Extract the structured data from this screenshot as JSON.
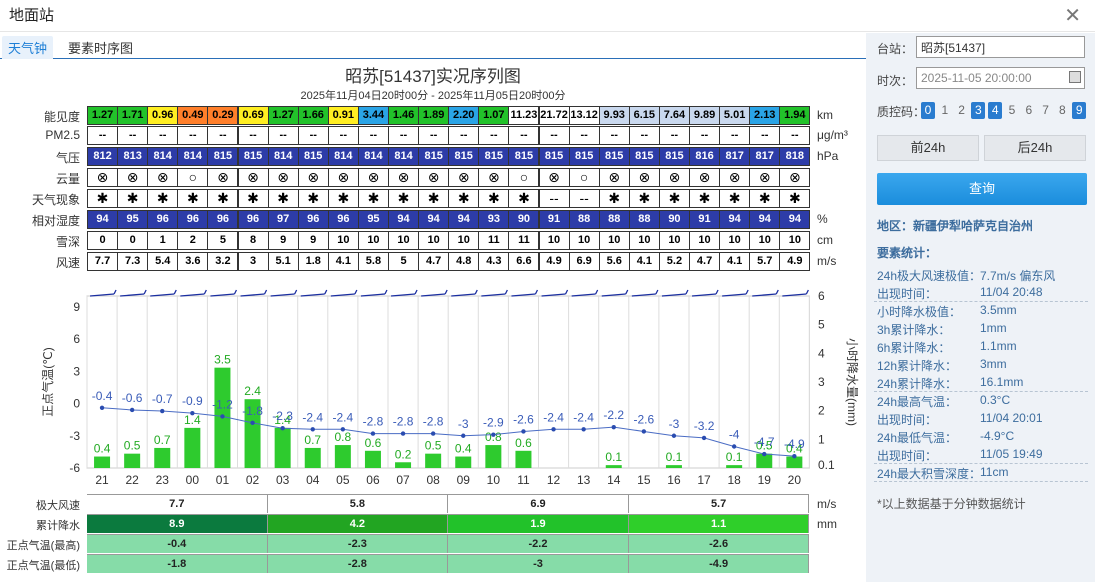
{
  "window": {
    "title": "地面站"
  },
  "tabs": [
    {
      "label": "天气钟",
      "active": true
    },
    {
      "label": "要素时序图",
      "active": false
    }
  ],
  "chart": {
    "title": "昭苏[51437]实况序列图",
    "subtitle": "2025年11月04日20时00分 - 2025年11月05日20时00分"
  },
  "rows": {
    "visibility": {
      "label": "能见度",
      "unit": "km",
      "values": [
        "1.27",
        "1.71",
        "0.96",
        "0.49",
        "0.29",
        "0.69",
        "1.27",
        "1.66",
        "0.91",
        "3.44",
        "1.46",
        "1.89",
        "2.20",
        "1.07",
        "11.23",
        "21.72",
        "13.12",
        "9.93",
        "6.15",
        "7.64",
        "9.89",
        "5.01",
        "2.13",
        "1.94"
      ],
      "colors": [
        "#22c22a",
        "#22c22a",
        "#ffee22",
        "#ff7f2a",
        "#ff7f2a",
        "#ffee22",
        "#22c22a",
        "#22c22a",
        "#ffee22",
        "#2aa4e6",
        "#22c22a",
        "#22c22a",
        "#2aa4e6",
        "#22c22a",
        "#ffffff",
        "#ffffff",
        "#ffffff",
        "#c9d8ee",
        "#c9d8ee",
        "#c9d8ee",
        "#c9d8ee",
        "#c9d8ee",
        "#2aa4e6",
        "#22c22a"
      ]
    },
    "pm25": {
      "label": "PM2.5",
      "unit": "μg/m³",
      "values": [
        "--",
        "--",
        "--",
        "--",
        "--",
        "--",
        "--",
        "--",
        "--",
        "--",
        "--",
        "--",
        "--",
        "--",
        "--",
        "--",
        "--",
        "--",
        "--",
        "--",
        "--",
        "--",
        "--",
        "--"
      ]
    },
    "pressure": {
      "label": "气压",
      "unit": "hPa",
      "values": [
        "812",
        "813",
        "814",
        "814",
        "815",
        "815",
        "814",
        "815",
        "814",
        "814",
        "814",
        "815",
        "815",
        "815",
        "815",
        "815",
        "815",
        "815",
        "815",
        "815",
        "816",
        "817",
        "817",
        "818"
      ]
    },
    "cloud": {
      "label": "云量",
      "values": [
        "⊗",
        "⊗",
        "⊗",
        "○",
        "⊗",
        "⊗",
        "⊗",
        "⊗",
        "⊗",
        "⊗",
        "⊗",
        "⊗",
        "⊗",
        "⊗",
        "○",
        "⊗",
        "○",
        "⊗",
        "⊗",
        "⊗",
        "⊗",
        "⊗",
        "⊗",
        "⊗"
      ]
    },
    "weather": {
      "label": "天气现象",
      "values": [
        "✱",
        "✱",
        "✱",
        "✱",
        "✱",
        "✱",
        "✱",
        "✱",
        "✱",
        "✱",
        "✱",
        "✱",
        "✱",
        "✱",
        "✱",
        "--",
        "--",
        "✱",
        "✱",
        "✱",
        "✱",
        "✱",
        "✱",
        "✱"
      ]
    },
    "humidity": {
      "label": "相对湿度",
      "unit": "%",
      "values": [
        "94",
        "95",
        "96",
        "96",
        "96",
        "96",
        "97",
        "96",
        "96",
        "95",
        "94",
        "94",
        "94",
        "93",
        "90",
        "91",
        "88",
        "88",
        "88",
        "90",
        "91",
        "94",
        "94",
        "94"
      ]
    },
    "snow": {
      "label": "雪深",
      "unit": "cm",
      "values": [
        "0",
        "0",
        "1",
        "2",
        "5",
        "8",
        "9",
        "9",
        "10",
        "10",
        "10",
        "10",
        "10",
        "11",
        "11",
        "10",
        "10",
        "10",
        "10",
        "10",
        "10",
        "10",
        "10",
        "10"
      ]
    },
    "wind": {
      "label": "风速",
      "unit": "m/s",
      "values": [
        "7.7",
        "7.3",
        "5.4",
        "3.6",
        "3.2",
        "3",
        "5.1",
        "1.8",
        "4.1",
        "5.8",
        "5",
        "4.7",
        "4.8",
        "4.3",
        "6.6",
        "4.9",
        "6.9",
        "5.6",
        "4.1",
        "5.2",
        "4.7",
        "4.1",
        "5.7",
        "4.9"
      ]
    }
  },
  "chart_data": {
    "type": "bar",
    "categories": [
      "21",
      "22",
      "23",
      "00",
      "01",
      "02",
      "03",
      "04",
      "05",
      "06",
      "07",
      "08",
      "09",
      "10",
      "11",
      "12",
      "13",
      "14",
      "15",
      "16",
      "17",
      "18",
      "19",
      "20"
    ],
    "ylabel": "正点气温(℃)",
    "y2label": "小时降水量(mm)",
    "ylim": [
      -6,
      10
    ],
    "y2lim": [
      0.1,
      6
    ],
    "yticks": [
      "9",
      "6",
      "3",
      "0",
      "-3",
      "-6"
    ],
    "y2ticks": [
      "6",
      "5",
      "4",
      "3",
      "2",
      "1",
      "0.1"
    ],
    "series": [
      {
        "type": "bar",
        "values": [
          0.4,
          0.5,
          0.7,
          1.4,
          3.5,
          2.4,
          1.4,
          0.7,
          0.8,
          0.6,
          0.2,
          0.5,
          0.4,
          0.8,
          0.6,
          0,
          0,
          0.1,
          0,
          0.1,
          0,
          0.1,
          0.5,
          0.4
        ],
        "labels": [
          "0.4",
          "0.5",
          "0.7",
          "1.4",
          "3.5",
          "2.4",
          "1.4",
          "0.7",
          "0.8",
          "0.6",
          "0.2",
          "0.5",
          "0.4",
          "0.8",
          "0.6",
          "",
          "",
          "0.1",
          "",
          "0.1",
          "",
          "0.1",
          "0.5",
          "0.4"
        ]
      },
      {
        "type": "line",
        "values": [
          -0.4,
          -0.6,
          -0.7,
          -0.9,
          -1.2,
          -1.8,
          -2.3,
          -2.4,
          -2.4,
          -2.8,
          -2.8,
          -2.8,
          -3,
          -2.9,
          -2.6,
          -2.4,
          -2.4,
          -2.2,
          -2.6,
          -3,
          -3.2,
          -4,
          -4.7,
          -4.9
        ],
        "labels": [
          "-0.4",
          "-0.6",
          "-0.7",
          "-0.9",
          "-1.2",
          "-1.8",
          "-2.3",
          "-2.4",
          "-2.4",
          "-2.8",
          "-2.8",
          "-2.8",
          "-3",
          "-2.9",
          "-2.6",
          "-2.4",
          "-2.4",
          "-2.2",
          "-2.6",
          "-3",
          "-3.2",
          "-4",
          "-4.7",
          "-4.9"
        ]
      }
    ]
  },
  "summary": {
    "rows": [
      {
        "label": "极大风速",
        "unit": "m/s",
        "values": [
          "7.7",
          "5.8",
          "6.9",
          "5.7"
        ],
        "colors": [
          "#ffffff",
          "#ffffff",
          "#ffffff",
          "#ffffff"
        ]
      },
      {
        "label": "累计降水",
        "unit": "mm",
        "values": [
          "8.9",
          "4.2",
          "1.9",
          "1.1"
        ],
        "colors": [
          "#0b7a3e",
          "#22a522",
          "#22c22a",
          "#2fcf2a"
        ]
      },
      {
        "label": "正点气温(最高)",
        "values": [
          "-0.4",
          "-2.3",
          "-2.2",
          "-2.6"
        ],
        "colors": [
          "#86dca8",
          "#86dca8",
          "#86dca8",
          "#86dca8"
        ]
      },
      {
        "label": "正点气温(最低)",
        "values": [
          "-1.8",
          "-2.8",
          "-3",
          "-4.9"
        ],
        "colors": [
          "#86dca8",
          "#86dca8",
          "#86dca8",
          "#86dca8"
        ]
      }
    ]
  },
  "sidebar": {
    "station_label": "台站：",
    "station_value": "昭苏[51437]",
    "time_label": "时次：",
    "time_value": "2025-11-05 20:00:00",
    "qc_label": "质控码：",
    "qc_codes": [
      "0",
      "1",
      "2",
      "3",
      "4",
      "5",
      "6",
      "7",
      "8",
      "9"
    ],
    "qc_on": [
      true,
      false,
      false,
      true,
      true,
      false,
      false,
      false,
      false,
      true
    ],
    "prev_label": "前24h",
    "next_label": "后24h",
    "query_label": "查询",
    "region": "地区：新疆伊犁哈萨克自治州",
    "stats_title": "要素统计：",
    "stats": [
      {
        "k": "24h极大风速极值：",
        "v": "7.7m/s 偏东风"
      },
      {
        "k": "出现时间：",
        "v": "11/04 20:48"
      },
      {
        "k": "小时降水极值：",
        "v": "3.5mm"
      },
      {
        "k": "3h累计降水：",
        "v": "1mm"
      },
      {
        "k": "6h累计降水：",
        "v": "1.1mm"
      },
      {
        "k": "12h累计降水：",
        "v": "3mm"
      },
      {
        "k": "24h累计降水：",
        "v": "16.1mm"
      },
      {
        "k": "24h最高气温：",
        "v": "0.3°C"
      },
      {
        "k": "出现时间：",
        "v": "11/04 20:01"
      },
      {
        "k": "24h最低气温：",
        "v": "-4.9°C"
      },
      {
        "k": "出现时间：",
        "v": "11/05 19:49"
      },
      {
        "k": "24h最大积雪深度：",
        "v": "11cm"
      }
    ],
    "note": "*以上数据基于分钟数据统计"
  }
}
